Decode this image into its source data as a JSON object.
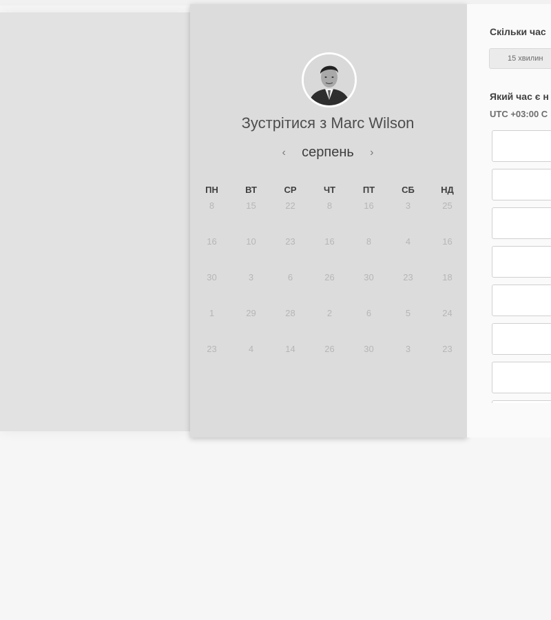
{
  "host": {
    "meet_title": "Зустрітися з Marc Wilson"
  },
  "calendar": {
    "month": "серпень",
    "weekdays": [
      "ПН",
      "ВТ",
      "СР",
      "ЧТ",
      "ПТ",
      "СБ",
      "НД"
    ],
    "days": [
      [
        "8",
        "15",
        "22",
        "8",
        "16",
        "3",
        "25"
      ],
      [
        "16",
        "10",
        "23",
        "16",
        "8",
        "4",
        "16"
      ],
      [
        "30",
        "3",
        "6",
        "26",
        "30",
        "23",
        "18"
      ],
      [
        "1",
        "29",
        "28",
        "2",
        "6",
        "5",
        "24"
      ],
      [
        "23",
        "4",
        "14",
        "26",
        "30",
        "3",
        "23"
      ]
    ]
  },
  "duration": {
    "title": "Скільки час",
    "option": "15 хвилин"
  },
  "time": {
    "title": "Який час є н",
    "timezone": "UTC +03:00 C"
  },
  "slots_count": 8
}
